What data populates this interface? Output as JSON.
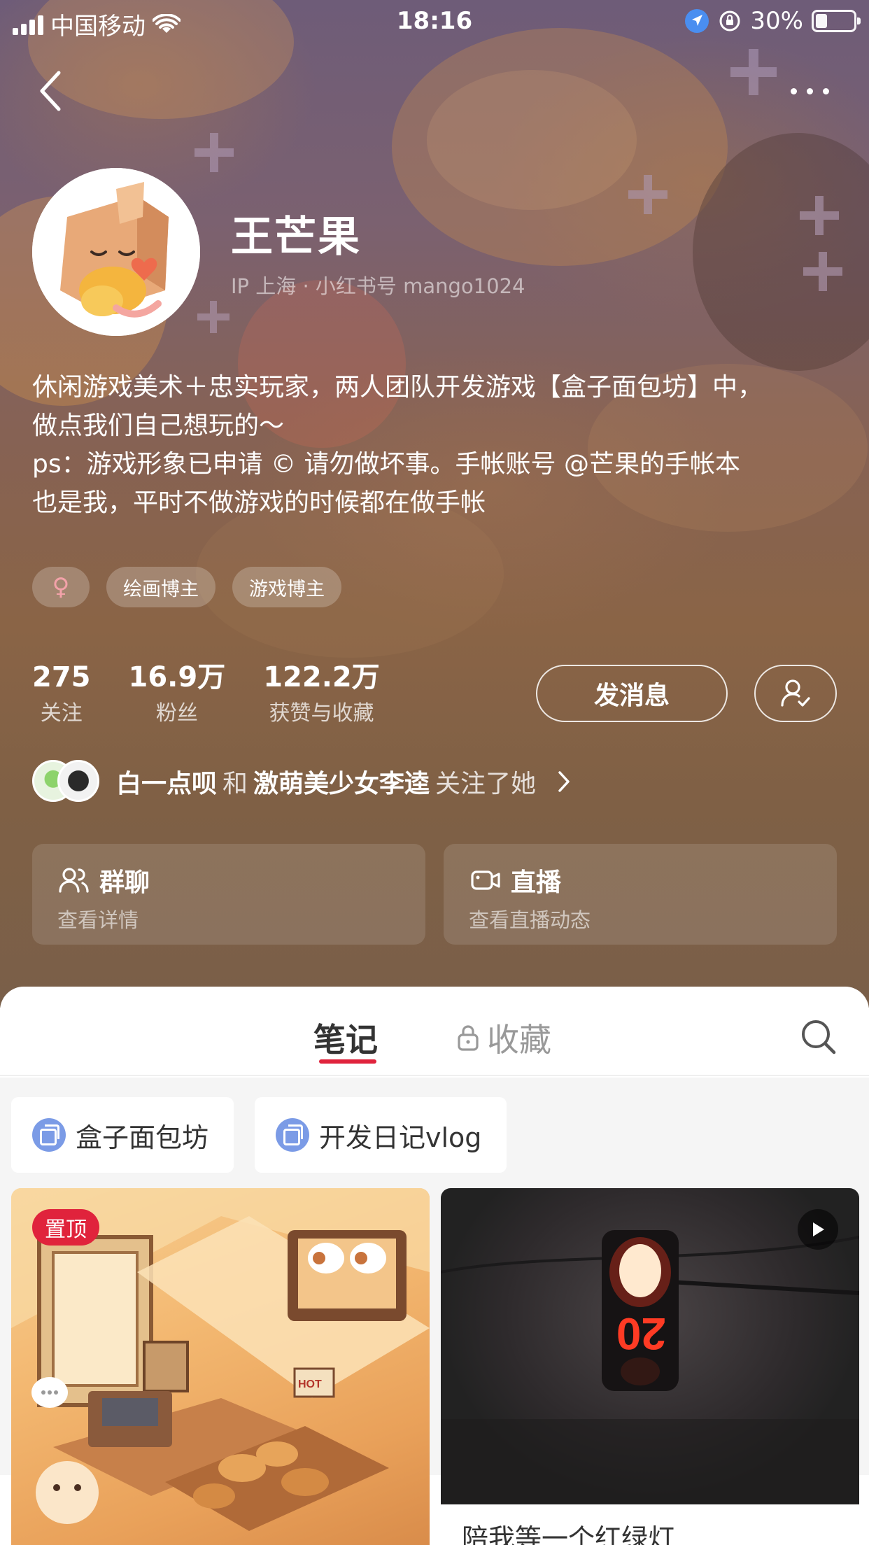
{
  "status_bar": {
    "carrier": "中国移动",
    "time": "18:16",
    "battery": "30%",
    "battery_level": 0.3
  },
  "profile": {
    "name": "王芒果",
    "ip_line": "IP 上海 · 小红书号 mango1024",
    "bio": [
      "休闲游戏美术＋忠实玩家，两人团队开发游戏【盒子面包坊】中，",
      "做点我们自己想玩的～",
      "ps：游戏形象已申请 © 请勿做坏事。手帐账号 @芒果的手帐本",
      "也是我，平时不做游戏的时候都在做手帐"
    ],
    "tags": {
      "gender": "♀",
      "items": [
        "绘画博主",
        "游戏博主"
      ]
    },
    "stats": [
      {
        "num": "275",
        "label": "关注"
      },
      {
        "num": "16.9万",
        "label": "粉丝"
      },
      {
        "num": "122.2万",
        "label": "获赞与收藏"
      }
    ],
    "message_button": "发消息",
    "mutual": {
      "user1": "白一点呗",
      "conj": "和",
      "user2": "激萌美少女李逵",
      "suffix": "关注了她"
    },
    "cards": [
      {
        "title": "群聊",
        "sub": "查看详情"
      },
      {
        "title": "直播",
        "sub": "查看直播动态"
      }
    ]
  },
  "tabs": {
    "notes": "笔记",
    "favorites": "收藏"
  },
  "collections": [
    "盒子面包坊",
    "开发日记vlog"
  ],
  "notes": [
    {
      "badge": "置顶",
      "illustration_text": "HOT"
    },
    {
      "caption": "陪我等一个红绿灯",
      "light_number": "20"
    }
  ],
  "colors": {
    "accent": "#e0233c",
    "collection_icon": "#7b9be6"
  }
}
